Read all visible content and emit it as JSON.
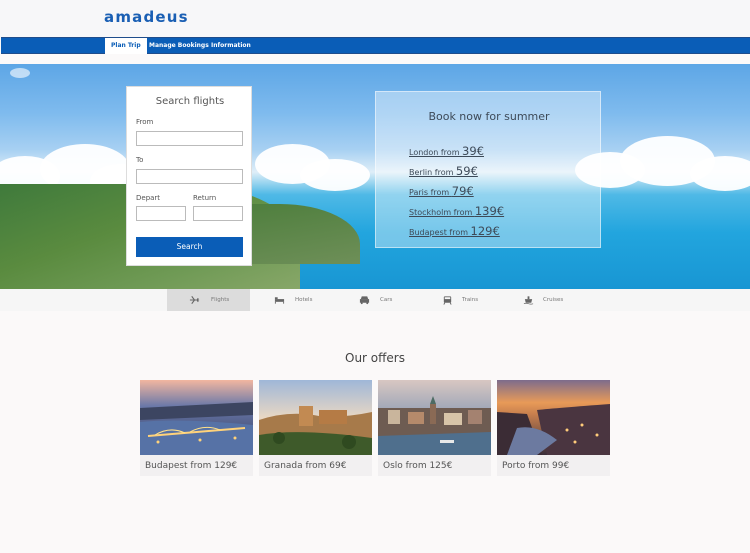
{
  "header": {
    "logo": "amadeus"
  },
  "nav": {
    "items": [
      {
        "label": "Plan Trip",
        "active": true
      },
      {
        "label": "Manage Bookings",
        "active": false
      },
      {
        "label": "Information",
        "active": false
      }
    ]
  },
  "search": {
    "title": "Search flights",
    "from_label": "From",
    "to_label": "To",
    "depart_label": "Depart",
    "return_label": "Return",
    "button": "Search"
  },
  "promo": {
    "title": "Book now for summer",
    "deals": [
      {
        "text": "London from ",
        "price": "39€"
      },
      {
        "text": "Berlin from ",
        "price": "59€"
      },
      {
        "text": "Paris from ",
        "price": "79€"
      },
      {
        "text": "Stockholm from ",
        "price": "139€"
      },
      {
        "text": "Budapest from ",
        "price": "129€"
      }
    ]
  },
  "tabs": [
    {
      "label": "Flights",
      "icon": "plane-icon",
      "active": true
    },
    {
      "label": "Hotels",
      "icon": "bed-icon",
      "active": false
    },
    {
      "label": "Cars",
      "icon": "car-icon",
      "active": false
    },
    {
      "label": "Trains",
      "icon": "train-icon",
      "active": false
    },
    {
      "label": "Cruises",
      "icon": "ship-icon",
      "active": false
    }
  ],
  "offers": {
    "title": "Our offers",
    "items": [
      {
        "caption": "Budapest from 129€"
      },
      {
        "caption": "Granada from 69€"
      },
      {
        "caption": "Oslo from 125€"
      },
      {
        "caption": "Porto from 99€"
      }
    ]
  },
  "colors": {
    "brand": "#0a5db7",
    "logo": "#1a5fb4"
  }
}
